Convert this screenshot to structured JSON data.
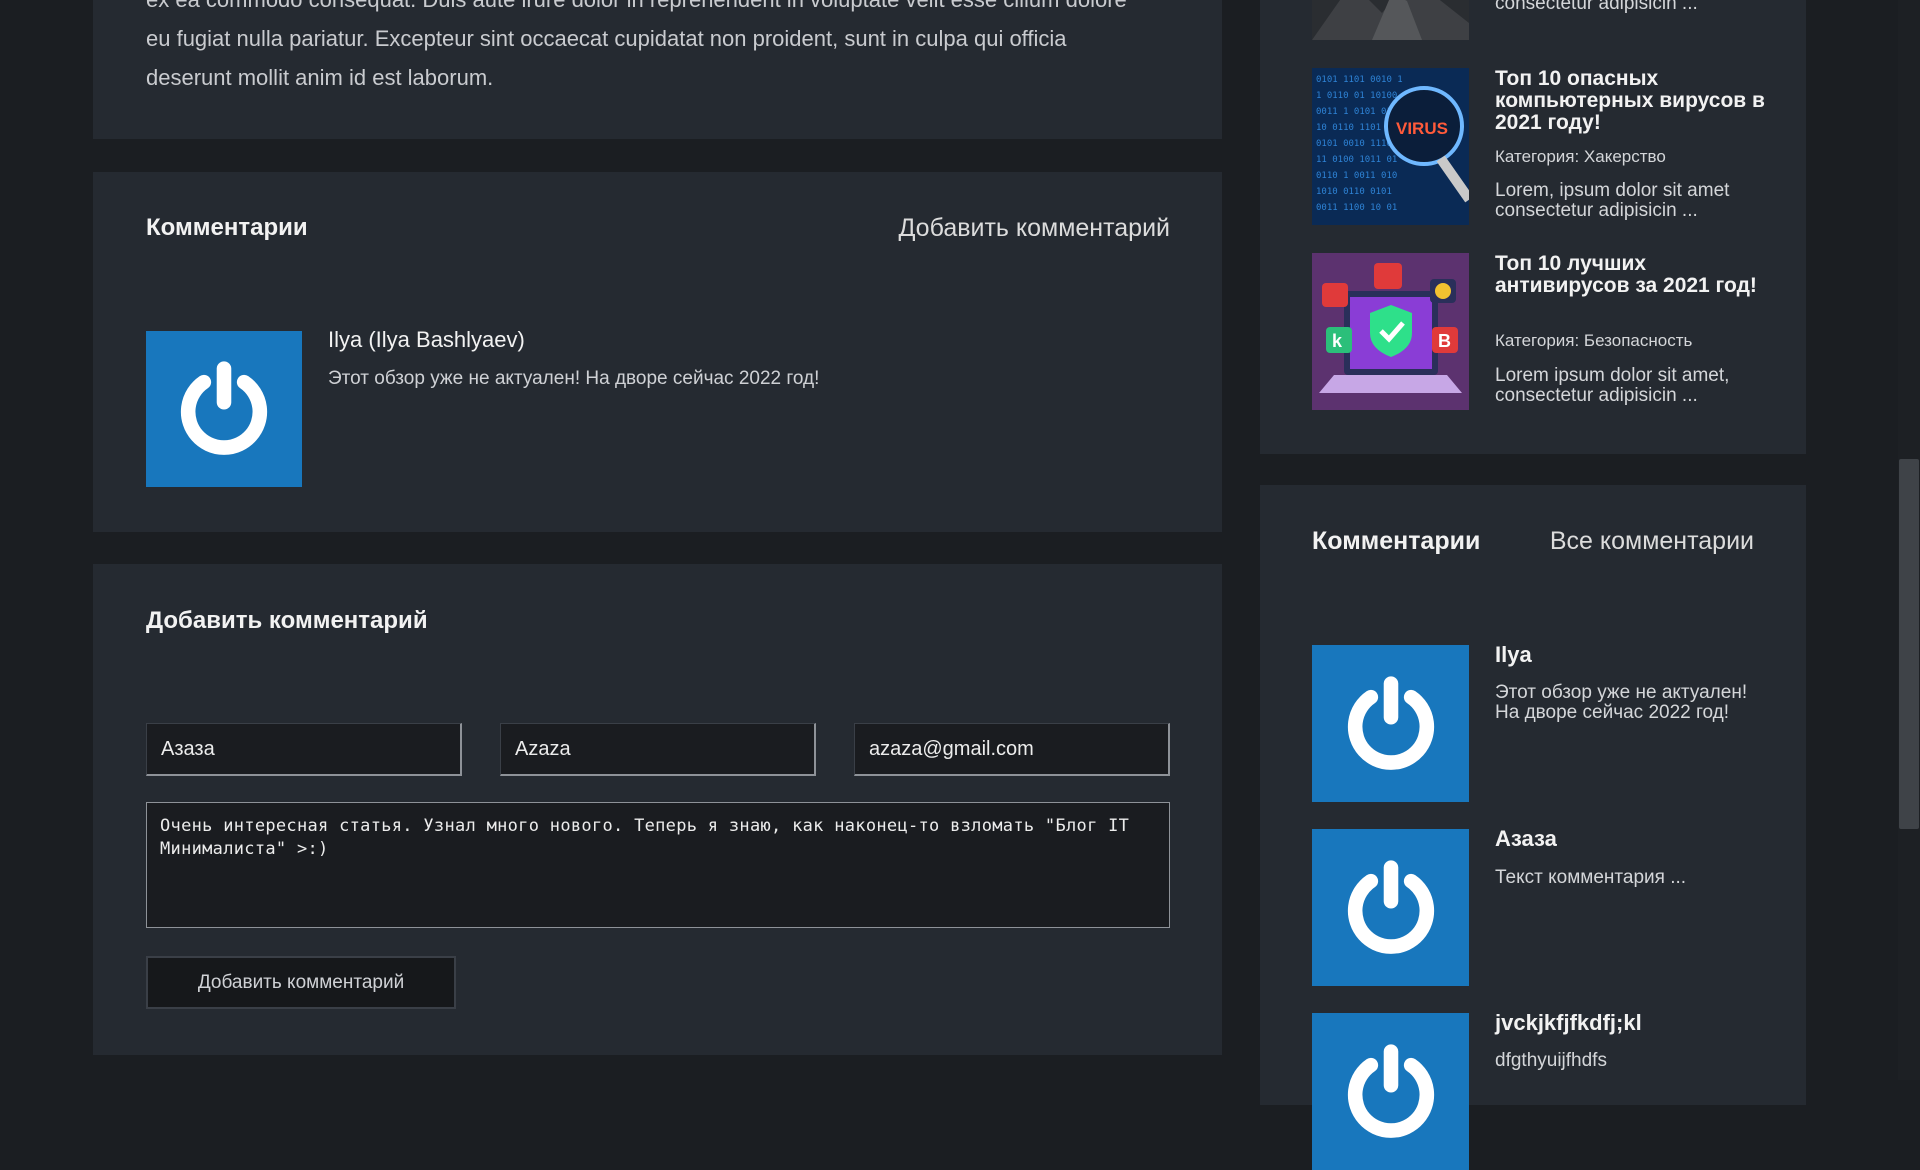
{
  "article": {
    "partial_text_line1": "ex ea commodo consequat. Duis aute irure dolor in reprehenderit in voluptate velit esse cillum dolore",
    "partial_text_line2": "eu fugiat nulla pariatur. Excepteur sint occaecat cupidatat non proident, sunt in culpa qui officia",
    "partial_text_line3": "deserunt mollit anim id est laborum."
  },
  "comments": {
    "title": "Комментарии",
    "add_link": "Добавить комментарий",
    "items": [
      {
        "author": "Ilya (Ilya Bashlyaev)",
        "text": "Этот обзор уже не актуален! На дворе сейчас 2022 год!",
        "avatar_icon": "power-icon"
      }
    ]
  },
  "form": {
    "title": "Добавить комментарий",
    "name_value": "Азаза",
    "login_value": "Azaza",
    "email_value": "azaza@gmail.com",
    "text_value": "Очень интересная статья. Узнал много нового. Теперь я знаю, как наконец-то взломать \"Блог IT Минималиста\" >:)",
    "submit_label": "Добавить комментарий"
  },
  "sidebar": {
    "posts": [
      {
        "title": "",
        "category": "",
        "excerpt": "consectetur adipisicin ..."
      },
      {
        "title": "Топ 10 опасных компьютерных вирусов в 2021 году!",
        "category": "Категория: Хакерство",
        "excerpt": "Lorem, ipsum dolor sit amet consectetur adipisicin ...",
        "thumb_text": "VIRUS"
      },
      {
        "title": "Топ 10 лучших антивирусов за 2021 год!",
        "category": "Категория: Безопасность",
        "excerpt": "Lorem ipsum dolor sit amet, consectetur adipisicin ..."
      }
    ],
    "comments": {
      "title": "Комментарии",
      "all_link": "Все комментарии",
      "items": [
        {
          "author": "Ilya",
          "text": "Этот обзор уже не актуален! На дворе сейчас 2022 год!"
        },
        {
          "author": "Азаза",
          "text": "Текст комментария ..."
        },
        {
          "author": "jvckjkfjfkdfj;kl",
          "text": "dfgthyuijfhdfs"
        }
      ]
    }
  },
  "colors": {
    "background": "#1b1e22",
    "panel": "#252a31",
    "avatar_blue": "#1877bd"
  }
}
